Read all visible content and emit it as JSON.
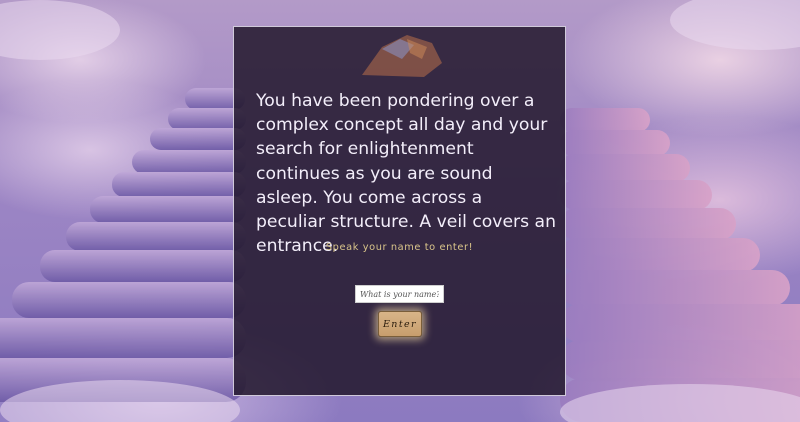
{
  "intro": {
    "story_text": "You have been pondering over a complex concept all day and your search for enlightenment continues as you are sound asleep. You come across a peculiar structure. A veil covers an entrance.",
    "prompt_text": "Speak your name to enter!"
  },
  "form": {
    "name_placeholder": "What is your name?",
    "name_value": "",
    "enter_label": "Enter"
  },
  "colors": {
    "panel_background": "#20162a",
    "prompt_text": "#d9c48a",
    "button_background": "#c9a273",
    "button_glow": "#ffe6aa"
  }
}
